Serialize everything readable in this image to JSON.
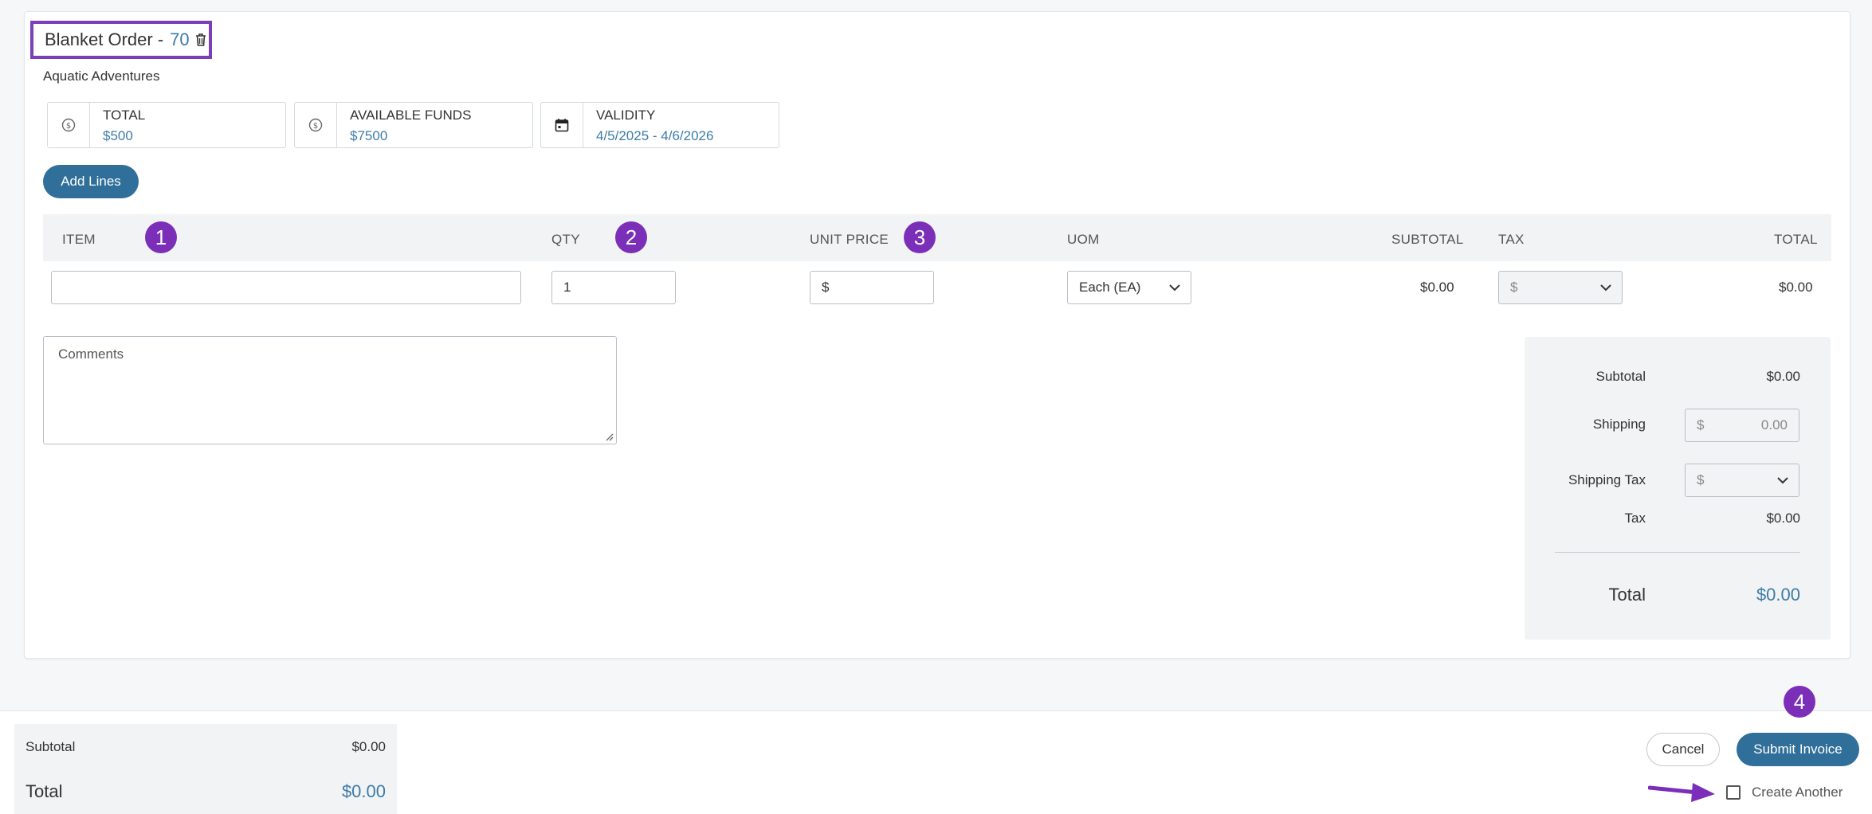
{
  "order": {
    "title": "Blanket Order - ",
    "number": "70",
    "vendor": "Aquatic Adventures"
  },
  "stats": {
    "total_label": "TOTAL",
    "total_value": "$500",
    "funds_label": "AVAILABLE FUNDS",
    "funds_value": "$7500",
    "validity_label": "VALIDITY",
    "validity_value": "4/5/2025 - 4/6/2026"
  },
  "add_lines_label": "Add Lines",
  "table": {
    "headers": {
      "item": "ITEM",
      "qty": "QTY",
      "unit_price": "UNIT PRICE",
      "uom": "UOM",
      "subtotal": "SUBTOTAL",
      "tax": "TAX",
      "total": "TOTAL"
    },
    "row": {
      "item_value": "",
      "qty_value": "1",
      "unit_price_prefix": "$",
      "uom_value": "Each (EA)",
      "subtotal": "$0.00",
      "tax_prefix": "$",
      "total": "$0.00"
    }
  },
  "comments_placeholder": "Comments",
  "summary": {
    "subtotal_label": "Subtotal",
    "subtotal_value": "$0.00",
    "shipping_label": "Shipping",
    "shipping_prefix": "$",
    "shipping_value": "0.00",
    "shipping_tax_label": "Shipping Tax",
    "shipping_tax_prefix": "$",
    "tax_label": "Tax",
    "tax_value": "$0.00",
    "total_label": "Total",
    "total_value": "$0.00"
  },
  "footer": {
    "subtotal_label": "Subtotal",
    "subtotal_value": "$0.00",
    "total_label": "Total",
    "total_value": "$0.00",
    "cancel_label": "Cancel",
    "submit_label": "Submit Invoice",
    "create_another_label": "Create Another"
  },
  "badges": [
    "1",
    "2",
    "3",
    "4"
  ],
  "colors": {
    "accent": "#2f6f99",
    "link": "#3c7ca7",
    "annotation": "#7b2fb8"
  },
  "icons": {
    "stat_total": "dollar-icon",
    "stat_funds": "dollar-icon",
    "stat_validity": "calendar-icon",
    "title_action": "trash-icon"
  }
}
